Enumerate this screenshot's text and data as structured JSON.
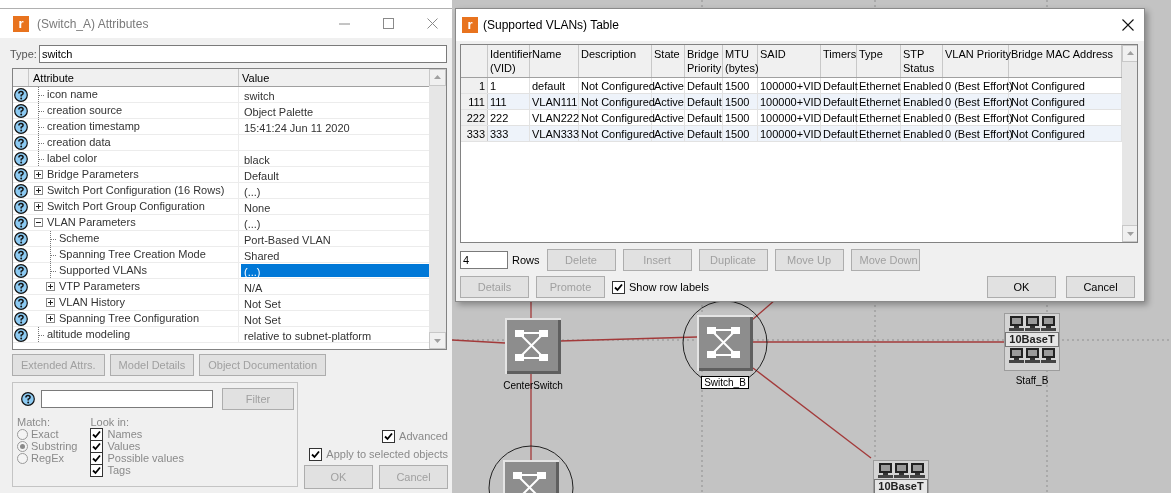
{
  "attributes_window": {
    "app_icon_letter": "r",
    "title": "(Switch_A) Attributes",
    "type_label": "Type:",
    "type_value": "switch",
    "columns": [
      "Attribute",
      "Value"
    ],
    "rows": [
      {
        "kind": "leaf",
        "name": "icon name",
        "value": "switch",
        "selected": false
      },
      {
        "kind": "leaf",
        "name": "creation source",
        "value": "Object Palette",
        "selected": false
      },
      {
        "kind": "leaf",
        "name": "creation timestamp",
        "value": "15:41:24 Jun 11 2020",
        "selected": false
      },
      {
        "kind": "leaf",
        "name": "creation data",
        "selected": false
      },
      {
        "kind": "leaf",
        "name": "label color",
        "value": "black",
        "selected": false
      },
      {
        "kind": "group",
        "name": "Bridge Parameters",
        "value": "Default",
        "expanded": false,
        "selected": false
      },
      {
        "kind": "group",
        "name": "Switch Port Configuration (16 Rows)",
        "value": "(...)",
        "expanded": false,
        "selected": false
      },
      {
        "kind": "group",
        "name": "Switch Port Group Configuration",
        "value": "None",
        "expanded": false,
        "selected": false
      },
      {
        "kind": "group",
        "name": "VLAN Parameters",
        "value": "(...)",
        "expanded": true,
        "selected": false,
        "children": [
          {
            "kind": "leaf",
            "name": "Scheme",
            "value": "Port-Based VLAN",
            "selected": false
          },
          {
            "kind": "leaf",
            "name": "Spanning Tree Creation Mode",
            "value": "Shared",
            "selected": false
          },
          {
            "kind": "leaf",
            "name": "Supported VLANs",
            "value": "(...)",
            "selected": true
          },
          {
            "kind": "group",
            "name": "VTP Parameters",
            "value": "N/A",
            "expanded": false,
            "selected": false
          },
          {
            "kind": "group",
            "name": "VLAN History",
            "value": "Not Set",
            "expanded": false,
            "selected": false
          },
          {
            "kind": "group",
            "name": "Spanning Tree Configuration",
            "value": "Not Set",
            "expanded": false,
            "selected": false
          }
        ]
      },
      {
        "kind": "leaf",
        "name": "altitude modeling",
        "value": "relative to subnet-platform",
        "selected": false
      }
    ],
    "buttons": [
      {
        "label": "Extended Attrs.",
        "disabled": true
      },
      {
        "label": "Model Details",
        "disabled": true
      },
      {
        "label": "Object Documentation",
        "disabled": true
      }
    ],
    "filter": {
      "button": {
        "label": "Filter",
        "disabled": true
      },
      "match_label": "Match:",
      "match_options": [
        {
          "label": "Exact",
          "selected": false
        },
        {
          "label": "Substring",
          "selected": true
        },
        {
          "label": "RegEx",
          "selected": false
        }
      ],
      "look_in_label": "Look in:",
      "look_in": [
        {
          "label": "Names",
          "checked": true
        },
        {
          "label": "Values",
          "checked": true
        },
        {
          "label": "Possible values",
          "checked": true
        },
        {
          "label": "Tags",
          "checked": true
        }
      ]
    },
    "advanced": {
      "label": "Advanced",
      "checked": true
    },
    "apply_to_selected": {
      "label": "Apply to selected objects",
      "checked": true
    },
    "dialog_buttons": [
      {
        "label": "OK",
        "disabled": true
      },
      {
        "label": "Cancel",
        "disabled": true
      }
    ]
  },
  "table_window": {
    "app_icon_letter": "r",
    "title": "(Supported VLANs) Table",
    "columns": [
      {
        "header": [
          "Identifier",
          "(VID)"
        ]
      },
      {
        "header": [
          "Name"
        ]
      },
      {
        "header": [
          "Description"
        ]
      },
      {
        "header": [
          "State"
        ]
      },
      {
        "header": [
          "Bridge",
          "Priority"
        ]
      },
      {
        "header": [
          "MTU",
          "(bytes)"
        ]
      },
      {
        "header": [
          "SAID"
        ]
      },
      {
        "header": [
          "Timers"
        ]
      },
      {
        "header": [
          "Type"
        ]
      },
      {
        "header": [
          "STP",
          "Status"
        ]
      },
      {
        "header": [
          "VLAN Priority"
        ]
      },
      {
        "header": [
          "Bridge MAC Address"
        ]
      }
    ],
    "rows": [
      {
        "label": "1",
        "cells": [
          "1",
          "default",
          "Not Configured",
          "Active",
          "Default",
          "1500",
          "100000+VID",
          "Default",
          "Ethernet",
          "Enabled",
          "0 (Best Effort)",
          "Not Configured"
        ]
      },
      {
        "label": "111",
        "cells": [
          "111",
          "VLAN111",
          "Not Configured",
          "Active",
          "Default",
          "1500",
          "100000+VID",
          "Default",
          "Ethernet",
          "Enabled",
          "0 (Best Effort)",
          "Not Configured"
        ]
      },
      {
        "label": "222",
        "cells": [
          "222",
          "VLAN222",
          "Not Configured",
          "Active",
          "Default",
          "1500",
          "100000+VID",
          "Default",
          "Ethernet",
          "Enabled",
          "0 (Best Effort)",
          "Not Configured"
        ]
      },
      {
        "label": "333",
        "cells": [
          "333",
          "VLAN333",
          "Not Configured",
          "Active",
          "Default",
          "1500",
          "100000+VID",
          "Default",
          "Ethernet",
          "Enabled",
          "0 (Best Effort)",
          "Not Configured"
        ]
      }
    ],
    "row_count": "4",
    "row_count_label": "Rows",
    "row_buttons": [
      {
        "label": "Delete",
        "disabled": true
      },
      {
        "label": "Insert",
        "disabled": true
      },
      {
        "label": "Duplicate",
        "disabled": true
      },
      {
        "label": "Move Up",
        "disabled": true
      },
      {
        "label": "Move Down",
        "disabled": true
      }
    ],
    "bottom_buttons": [
      {
        "label": "Details",
        "disabled": true
      },
      {
        "label": "Promote",
        "disabled": true
      }
    ],
    "show_row_labels": {
      "label": "Show row labels",
      "checked": true
    },
    "dialog_buttons": [
      {
        "label": "OK",
        "disabled": false
      },
      {
        "label": "Cancel",
        "disabled": false
      }
    ]
  },
  "canvas": {
    "nodes": [
      {
        "kind": "switch",
        "label": "CenterSwitch",
        "highlighted": false,
        "selected": false
      },
      {
        "kind": "switch",
        "label": "Switch_B",
        "highlighted": true,
        "selected": true
      },
      {
        "kind": "hub",
        "label": "Staff_B",
        "badge": "10BaseT",
        "highlighted": false,
        "selected": false
      },
      {
        "kind": "hub",
        "badge": "10BaseT",
        "highlighted": false
      },
      {
        "kind": "switch",
        "highlighted": true
      }
    ]
  }
}
